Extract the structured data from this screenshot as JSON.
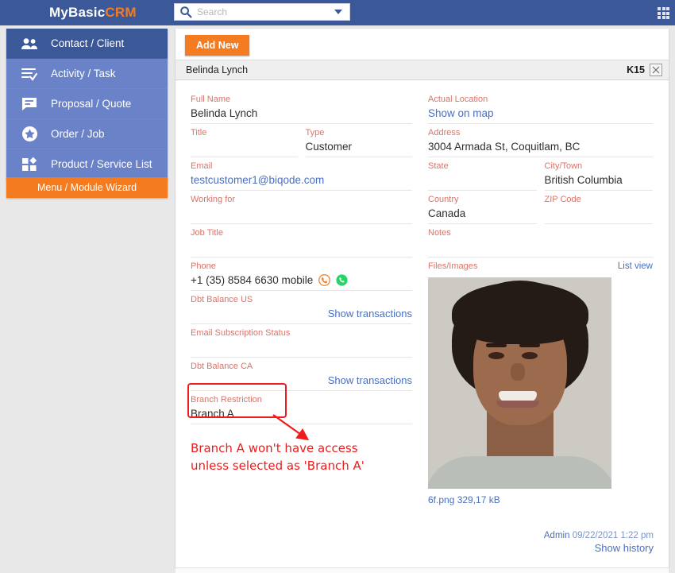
{
  "topbar": {
    "brand_primary": "MyBasic",
    "brand_accent": "CRM",
    "search_placeholder": "Search",
    "search_value": "",
    "search_icon": "search-icon",
    "dropdown_icon": "chevron-down-icon",
    "apps_icon": "apps-grid-icon",
    "bg_color": "#3b5998",
    "accent_color": "#f47b20"
  },
  "sidebar": {
    "bg_color": "#6a83c8",
    "active_color": "#3b5998",
    "items": [
      {
        "label": "Contact / Client",
        "icon": "people-icon",
        "active": true
      },
      {
        "label": "Activity / Task",
        "icon": "task-list-check-icon",
        "active": false
      },
      {
        "label": "Proposal / Quote",
        "icon": "speech-bubble-icon",
        "active": false
      },
      {
        "label": "Order / Job",
        "icon": "star-circle-icon",
        "active": false
      },
      {
        "label": "Product / Service List",
        "icon": "widgets-icon",
        "active": false
      }
    ],
    "wizard_label": "Menu / Module Wizard"
  },
  "main": {
    "add_new_label": "Add New",
    "record": {
      "title": "Belinda Lynch",
      "code": "K15",
      "close_icon": "close-icon"
    },
    "left_fields": [
      {
        "label": "Full Name",
        "value": "Belinda Lynch",
        "type": "text"
      },
      {
        "label": "Title",
        "value": "",
        "label2": "Type",
        "value2": "Customer",
        "type": "pair"
      },
      {
        "label": "Email",
        "value": "testcustomer1@biqode.com",
        "type": "link"
      },
      {
        "label": "Working for",
        "value": "",
        "type": "text"
      },
      {
        "label": "Job Title",
        "value": "",
        "type": "text"
      },
      {
        "label": "Phone",
        "value": "+1 (35) 8584 6630 mobile",
        "type": "phone",
        "icons": [
          "phone-call-icon",
          "whatsapp-icon"
        ]
      },
      {
        "label": "Dbt Balance US",
        "value": "",
        "type": "action",
        "action": "Show transactions"
      },
      {
        "label": "Email Subscription Status",
        "value": "",
        "type": "text"
      },
      {
        "label": "Dbt Balance CA",
        "value": "",
        "type": "action",
        "action": "Show transactions"
      },
      {
        "label": "Branch Restriction",
        "value": "Branch A",
        "type": "text",
        "highlighted": true
      }
    ],
    "right_fields": [
      {
        "label": "Actual Location",
        "value": "Show on map",
        "type": "link"
      },
      {
        "label": "Address",
        "value": "3004 Armada St, Coquitlam, BC",
        "type": "text"
      },
      {
        "label": "State",
        "value": "",
        "label2": "City/Town",
        "value2": "British Columbia",
        "type": "pair"
      },
      {
        "label": "Country",
        "value": "Canada",
        "label2": "ZIP Code",
        "value2": "",
        "type": "pair"
      },
      {
        "label": "Notes",
        "value": "",
        "type": "text"
      }
    ],
    "files": {
      "label": "Files/Images",
      "list_view_label": "List view",
      "image_alt": "portrait-photo",
      "filename": "6f.png 329,17 kB"
    },
    "footer": {
      "author": "Admin",
      "timestamp": "09/22/2021 1:22 pm",
      "show_history_label": "Show history"
    }
  },
  "annotation": {
    "color": "#ee1c1c",
    "text": "Branch A won't have access\nunless selected as 'Branch A'"
  }
}
